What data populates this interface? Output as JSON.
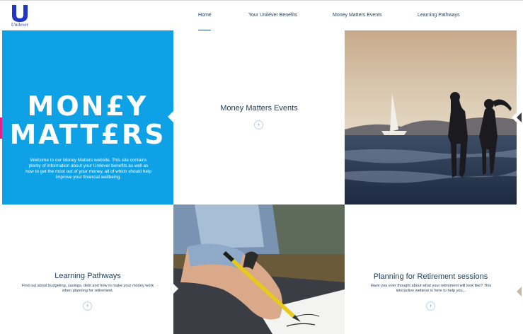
{
  "brand": {
    "logo_text": "Unilever",
    "logo_color": "#1f36c7"
  },
  "nav": {
    "items": [
      {
        "label": "Home"
      },
      {
        "label": "Your Unilever Benefits"
      },
      {
        "label": "Money Matters Events"
      },
      {
        "label": "Learning Pathways"
      }
    ]
  },
  "hero": {
    "title_line1": "MON£Y",
    "title_line2": "MATT£RS",
    "body": "Welcome to our Money Matters website. This site contains plenty of information about your Unilever benefits as well as how to get the most out of your money, all of which should help improve your financial wellbeing.",
    "color": "#0ea1e6"
  },
  "events": {
    "heading": "Money Matters Events",
    "arrow": "›"
  },
  "learning": {
    "heading": "Learning Pathways",
    "body": "Find out about budgeting, savings, debt and how to make your money work when planning for retirement.",
    "arrow": "›"
  },
  "retirement": {
    "heading": "Planning for Retirement sessions",
    "body": "Have you ever thought about what your retirement will look like? This interactive webinar is here to help you...",
    "arrow": "›"
  },
  "images": {
    "photo1": "couple-silhouette-sea-sailboat",
    "photo2": "hand-writing-with-pen"
  }
}
